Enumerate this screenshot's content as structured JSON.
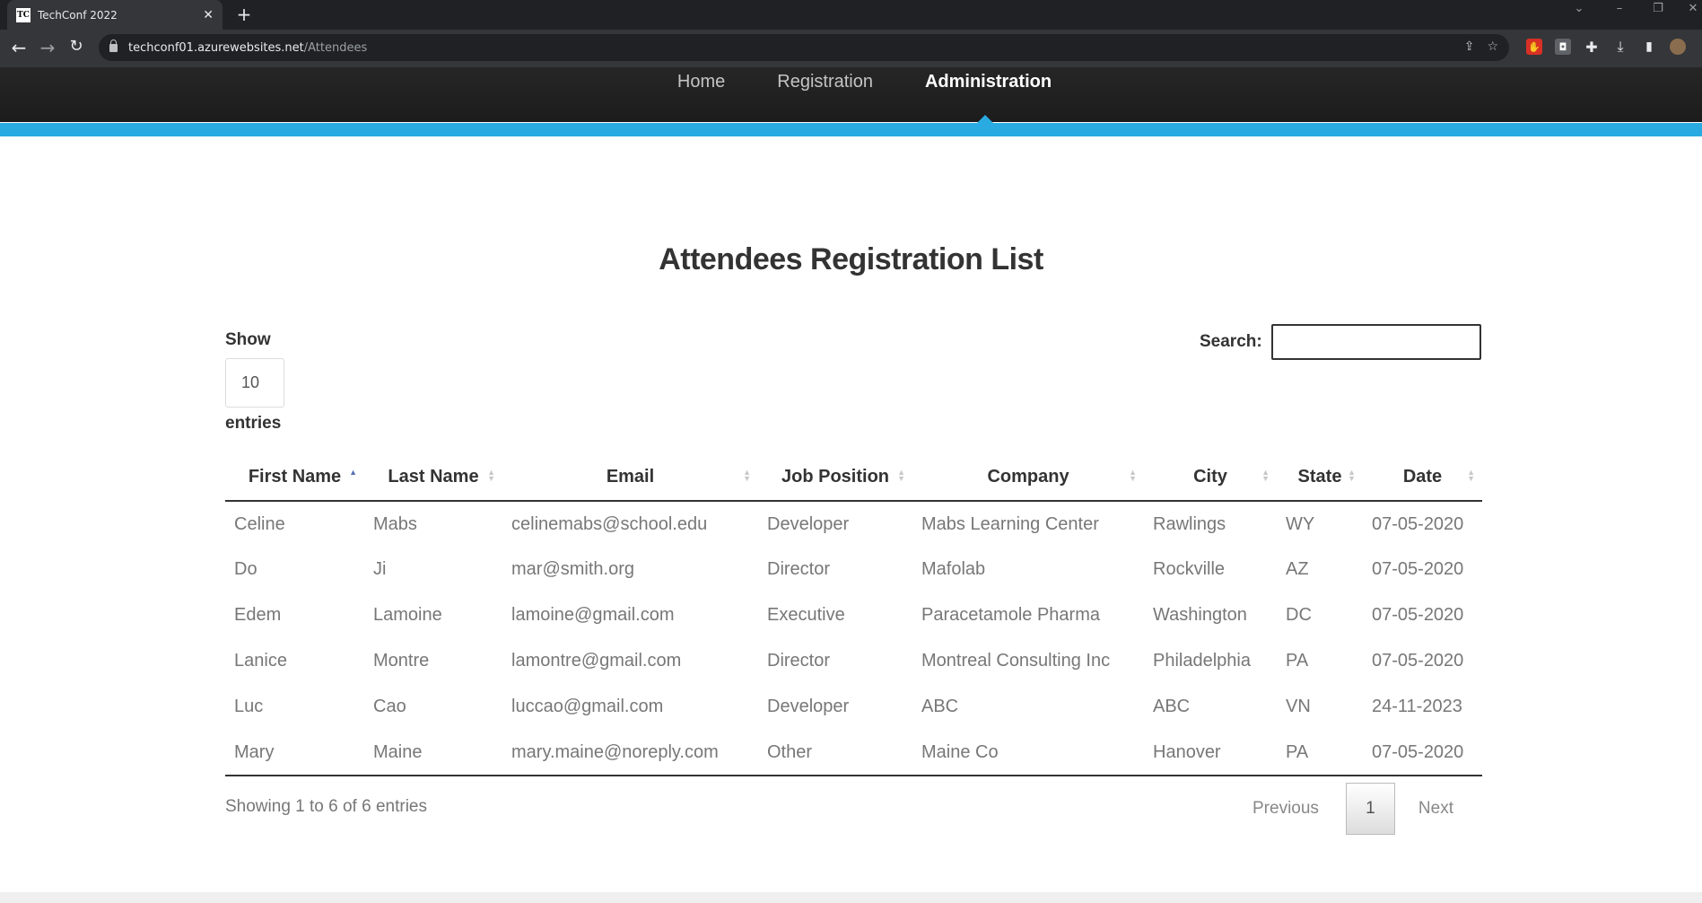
{
  "browser": {
    "tab_title": "TechConf 2022",
    "favicon_text": "TC",
    "url_domain": "techconf01.azurewebsites.net",
    "url_path": "/Attendees"
  },
  "nav": {
    "home": "Home",
    "registration": "Registration",
    "administration": "Administration"
  },
  "page": {
    "title": "Attendees Registration List",
    "show_label": "Show",
    "entries_value": "10",
    "entries_label": "entries",
    "search_label": "Search:",
    "search_value": ""
  },
  "table": {
    "columns": [
      "First Name",
      "Last Name",
      "Email",
      "Job Position",
      "Company",
      "City",
      "State",
      "Date"
    ],
    "rows": [
      [
        "Celine",
        "Mabs",
        "celinemabs@school.edu",
        "Developer",
        "Mabs Learning Center",
        "Rawlings",
        "WY",
        "07-05-2020"
      ],
      [
        "Do",
        "Ji",
        "mar@smith.org",
        "Director",
        "Mafolab",
        "Rockville",
        "AZ",
        "07-05-2020"
      ],
      [
        "Edem",
        "Lamoine",
        "lamoine@gmail.com",
        "Executive",
        "Paracetamole Pharma",
        "Washington",
        "DC",
        "07-05-2020"
      ],
      [
        "Lanice",
        "Montre",
        "lamontre@gmail.com",
        "Director",
        "Montreal Consulting Inc",
        "Philadelphia",
        "PA",
        "07-05-2020"
      ],
      [
        "Luc",
        "Cao",
        "luccao@gmail.com",
        "Developer",
        "ABC",
        "ABC",
        "VN",
        "24-11-2023"
      ],
      [
        "Mary",
        "Maine",
        "mary.maine@noreply.com",
        "Other",
        "Maine Co",
        "Hanover",
        "PA",
        "07-05-2020"
      ]
    ]
  },
  "footer": {
    "info": "Showing 1 to 6 of 6 entries",
    "previous": "Previous",
    "current_page": "1",
    "next": "Next"
  },
  "colors": {
    "accent": "#29abe2",
    "header_bg": "#222222"
  }
}
